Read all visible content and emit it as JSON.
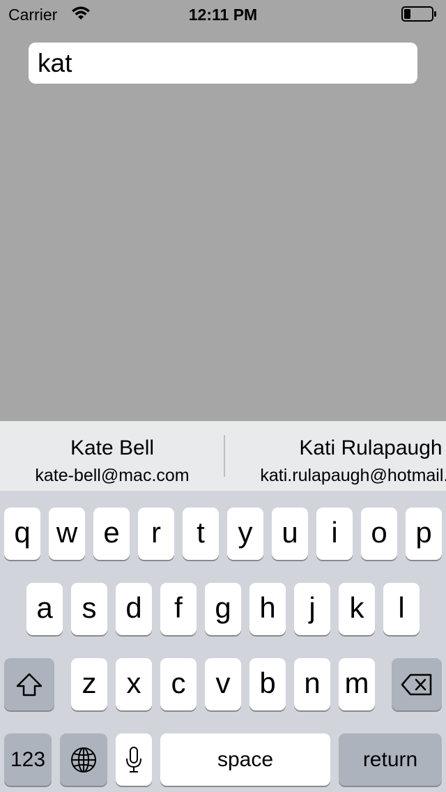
{
  "status_bar": {
    "carrier": "Carrier",
    "time": "12:11 PM",
    "icons": [
      "wifi-icon",
      "battery-icon"
    ]
  },
  "search": {
    "value": "kat"
  },
  "suggestions": [
    {
      "name": "Kate Bell",
      "email": "kate-bell@mac.com"
    },
    {
      "name": "Kati Rulapaugh",
      "email": "kati.rulapaugh@hotmail.com"
    }
  ],
  "keyboard": {
    "row1": [
      "q",
      "w",
      "e",
      "r",
      "t",
      "y",
      "u",
      "i",
      "o",
      "p"
    ],
    "row2": [
      "a",
      "s",
      "d",
      "f",
      "g",
      "h",
      "j",
      "k",
      "l"
    ],
    "row3": [
      "z",
      "x",
      "c",
      "v",
      "b",
      "n",
      "m"
    ],
    "numbers_label": "123",
    "space_label": "space",
    "return_label": "return",
    "icons": [
      "shift-icon",
      "delete-icon",
      "globe-icon",
      "microphone-icon"
    ]
  },
  "colors": {
    "background": "#a6a6a6",
    "keyboard": "#d1d4da",
    "key": "#ffffff",
    "special_key": "#acb3bd",
    "suggestion_bar": "#e9eaeb"
  }
}
